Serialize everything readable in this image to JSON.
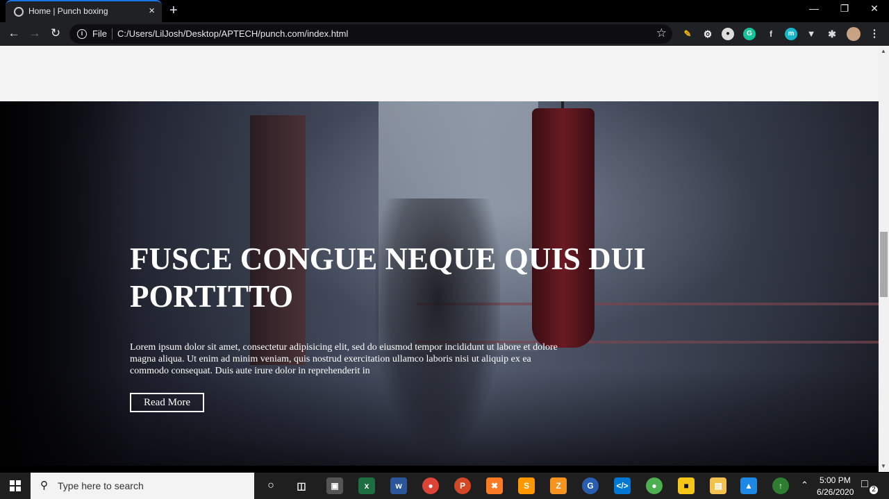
{
  "browser": {
    "tab_title": "Home | Punch boxing",
    "tab_close": "×",
    "new_tab": "+",
    "file_label": "File",
    "url": "C:/Users/LilJosh/Desktop/APTECH/punch.com/index.html",
    "window_controls": {
      "minimize": "—",
      "restore": "❐",
      "close": "✕"
    }
  },
  "hero": {
    "title": "Fusce congue neque quis dui portitto",
    "text": "Lorem ipsum dolor sit amet, consectetur adipisicing elit, sed do eiusmod tempor incididunt ut labore et dolore magna aliqua. Ut enim ad minim veniam, quis nostrud exercitation ullamco laboris nisi ut aliquip ex ea commodo consequat. Duis aute irure dolor in reprehenderit in",
    "button_label": "Read More"
  },
  "taskbar": {
    "search_placeholder": "Type here to search",
    "time": "5:00 PM",
    "date": "6/26/2020",
    "notification_count": "2"
  },
  "colors": {
    "tab_accent": "#1a73e8",
    "chrome_dark": "#202124",
    "hero_text": "#ffffff"
  },
  "icons": {
    "extensions": [
      "pencil-icon",
      "gear-icon",
      "bulb-icon",
      "grammarly-icon",
      "font-icon",
      "meet-icon",
      "vuetify-icon",
      "puzzle-icon",
      "avatar"
    ],
    "taskbar": [
      "cortana-icon",
      "task-view-icon",
      "store-icon",
      "excel-icon",
      "word-icon",
      "chrome-icon",
      "powerpoint-icon",
      "xampp-icon",
      "sublime-icon",
      "filezilla-icon",
      "app-icon",
      "vscode-icon",
      "internet-icon",
      "xampp-control-icon",
      "file-explorer-icon",
      "photos-icon",
      "git-icon"
    ]
  }
}
